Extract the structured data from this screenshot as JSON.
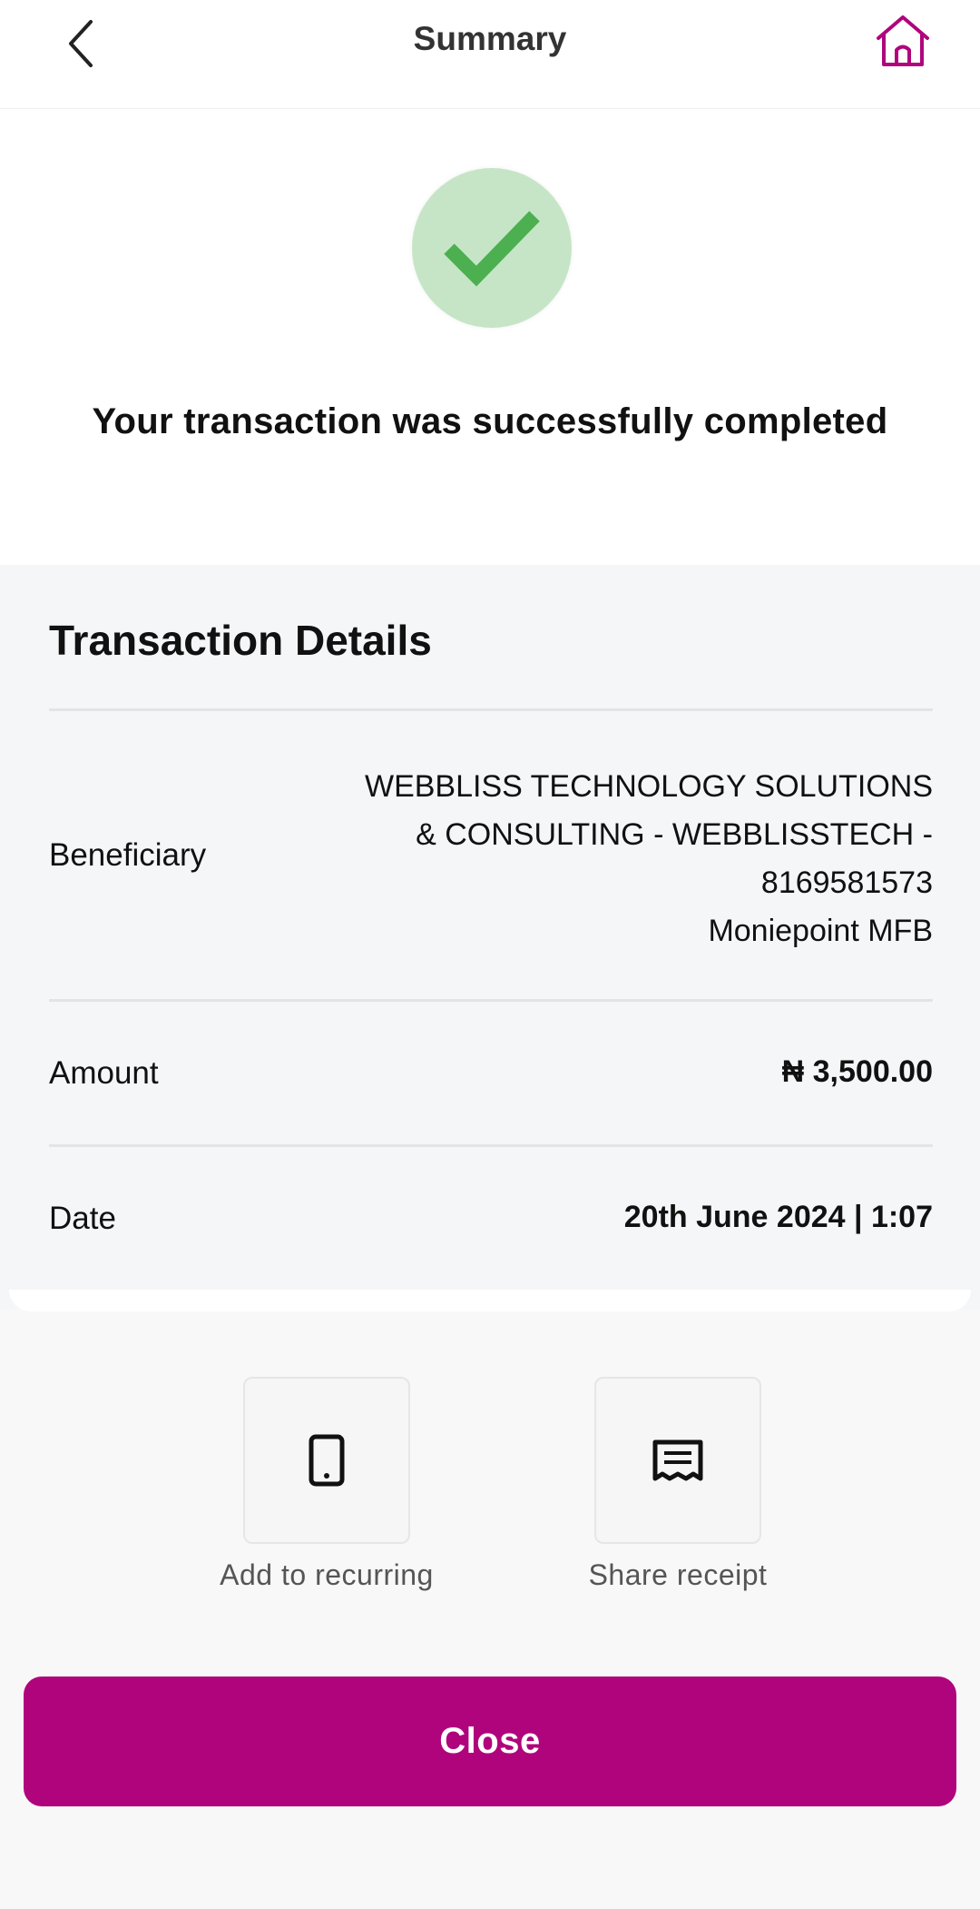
{
  "header": {
    "title": "Summary",
    "back_icon": "chevron-left-icon",
    "home_icon": "home-icon"
  },
  "status": {
    "icon": "check-icon",
    "message": "Your transaction was successfully completed"
  },
  "details": {
    "title": "Transaction Details",
    "beneficiary": {
      "label": "Beneficiary",
      "lines": [
        "WEBBLISS TECHNOLOGY SOLUTIONS",
        "& CONSULTING - WEBBLISSTECH -",
        "8169581573",
        "Moniepoint MFB"
      ]
    },
    "amount": {
      "label": "Amount",
      "value": "₦ 3,500.00"
    },
    "date": {
      "label": "Date",
      "value": "20th June 2024 | 1:07"
    }
  },
  "actions": [
    {
      "label": "Add to recurring",
      "icon": "phone-icon"
    },
    {
      "label": "Share receipt",
      "icon": "receipt-icon"
    }
  ],
  "close_label": "Close",
  "colors": {
    "brand": "#b0047c",
    "success_bg": "#c6e5c7",
    "success_check": "#4caf50"
  }
}
